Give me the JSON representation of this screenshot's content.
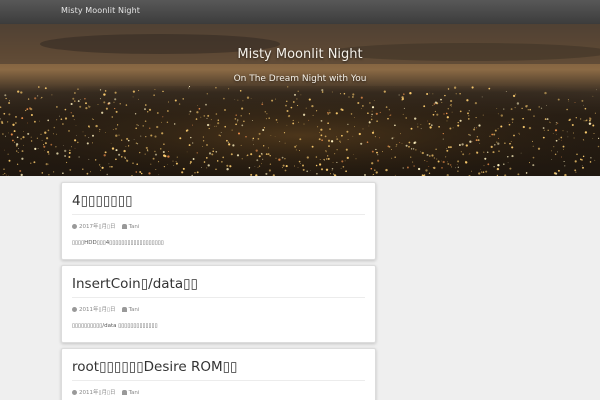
{
  "topbar": {
    "brand": "Misty Moonlit Night"
  },
  "header": {
    "title": "Misty Moonlit Night",
    "tagline": "On The Dream Night with You"
  },
  "posts": [
    {
      "title": "4▯▯▯▯▯▯▯",
      "date": "2017年▯月▯日",
      "author": "Tani",
      "excerpt": "▯▯▯▯HDD▯▯▯4▯▯▯▯▯▯▯▯▯▯▯▯▯▯▯▯▯▯"
    },
    {
      "title": "InsertCoin▯/data▯▯",
      "date": "2011年▯月▯日",
      "author": "Tani",
      "excerpt": "▯▯▯▯▯▯▯▯▯▯/data ▯▯▯▯▯▯▯▯▯▯▯▯▯"
    },
    {
      "title": "root▯▯▯▯▯▯Desire ROM▯▯",
      "date": "2011年▯月▯日",
      "author": "Tani",
      "excerpt": ""
    }
  ]
}
